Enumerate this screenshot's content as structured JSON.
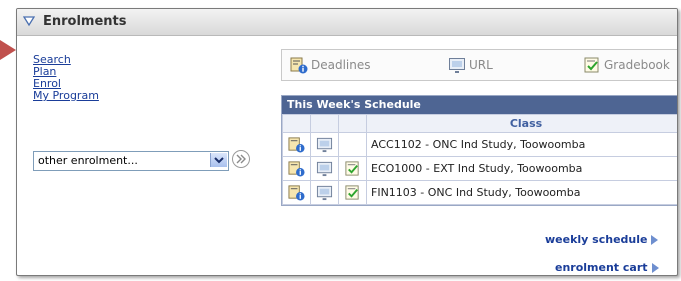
{
  "header": {
    "title": "Enrolments"
  },
  "nav_links": [
    "Search",
    "Plan",
    "Enrol",
    "My Program"
  ],
  "enrolment_select": {
    "value": "other enrolment..."
  },
  "toolbar": {
    "deadlines": "Deadlines",
    "url": "URL",
    "gradebook": "Gradebook"
  },
  "schedule": {
    "title": "This Week's Schedule",
    "column_header": "Class",
    "rows": [
      {
        "class": "ACC1102 - ONC Ind Study, Toowoomba",
        "gradebook": false
      },
      {
        "class": "ECO1000 - EXT Ind Study, Toowoomba",
        "gradebook": true
      },
      {
        "class": "FIN1103 - ONC Ind Study, Toowoomba",
        "gradebook": true
      }
    ]
  },
  "links": {
    "weekly_schedule": "weekly schedule",
    "enrolment_cart": "enrolment cart"
  },
  "colors": {
    "header_bar": "#4e6593",
    "link": "#1a3d99",
    "callout_arrow": "#c0504d"
  },
  "icons": {
    "section_toggle": "triangle-down-icon",
    "deadlines": "calendar-info-icon",
    "url": "link-monitor-icon",
    "gradebook": "gradebook-check-icon",
    "go": "double-chevron-icon"
  }
}
